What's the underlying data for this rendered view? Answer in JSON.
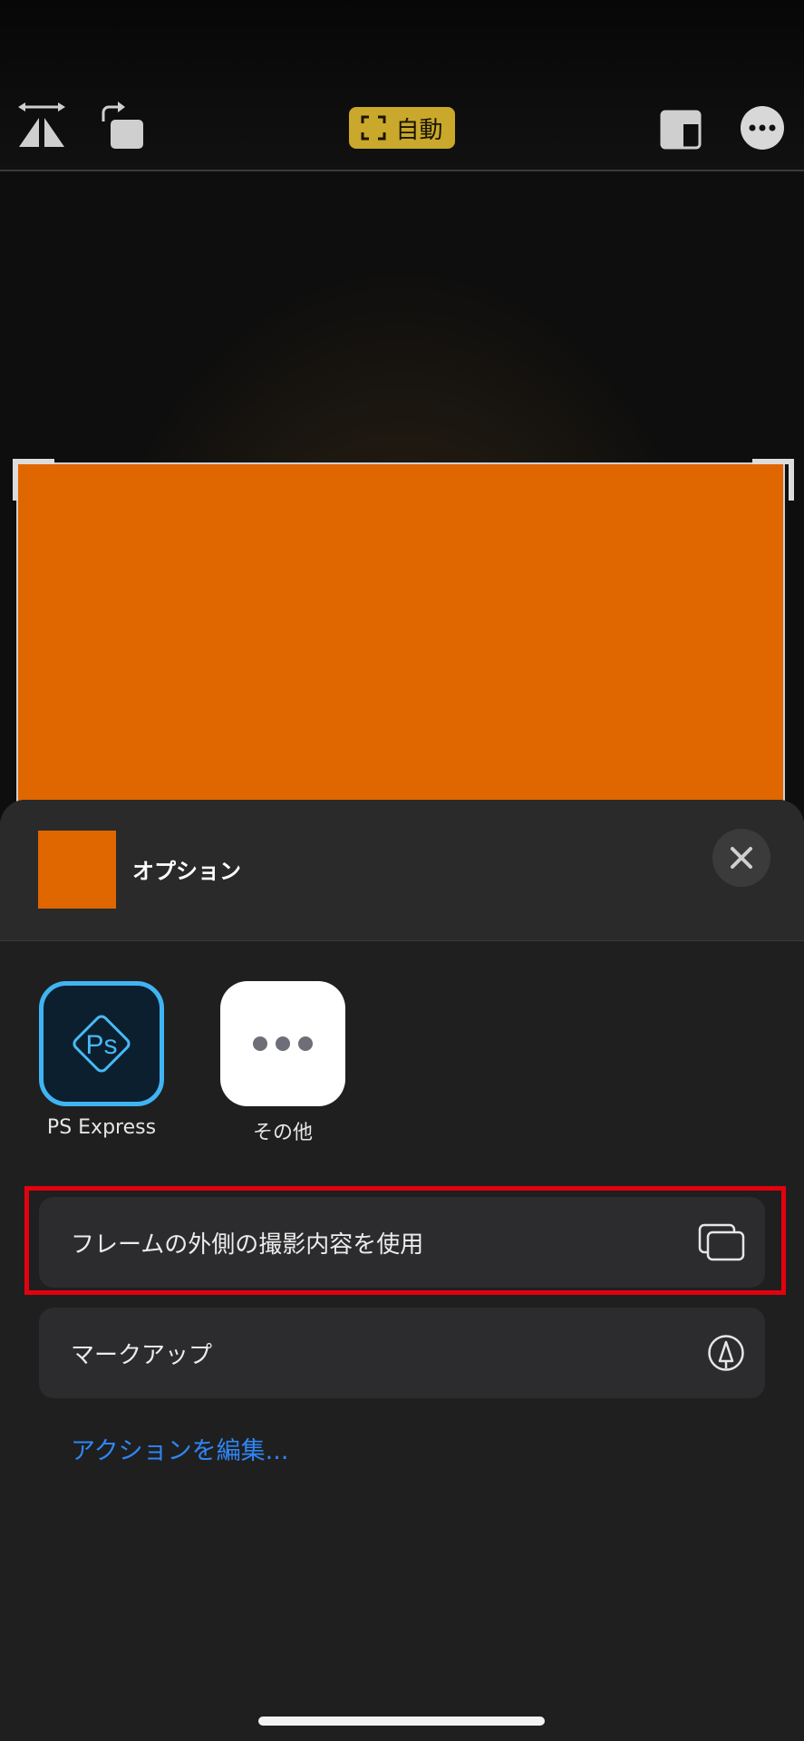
{
  "toolbar": {
    "flip_icon": "flip-horizontal-icon",
    "rotate_icon": "rotate-icon",
    "auto_label": "自動",
    "aspect_icon": "aspect-ratio-icon",
    "more_icon": "more-icon"
  },
  "photo": {
    "color": "#e06600"
  },
  "sheet": {
    "title": "オプション",
    "close_icon": "close-icon",
    "apps": [
      {
        "label": "PS Express",
        "icon": "ps-express-icon"
      },
      {
        "label": "その他",
        "icon": "more-apps-icon"
      }
    ],
    "actions": [
      {
        "label": "フレームの外側の撮影内容を使用",
        "icon": "overlapping-squares-icon"
      },
      {
        "label": "マークアップ",
        "icon": "markup-pen-icon"
      }
    ],
    "edit_actions": "アクションを編集..."
  },
  "colors": {
    "accent_auto": "#c9a82c",
    "link": "#2f86f5",
    "highlight": "#e3000f"
  }
}
